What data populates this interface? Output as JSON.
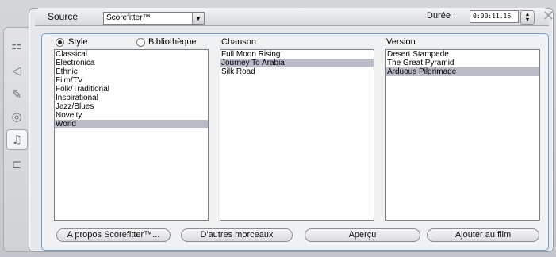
{
  "header": {
    "source_label": "Source",
    "source_value": "Scorefitter™",
    "duration_label": "Durée :",
    "duration_value": "0:00:11.16"
  },
  "sidebar": {
    "icons": [
      "timeline-icon",
      "audio-icon",
      "voice-icon",
      "disc-icon",
      "music-icon",
      "record-icon"
    ]
  },
  "columns": {
    "style_label": "Style",
    "library_label": "Bibliothèque",
    "song_label": "Chanson",
    "version_label": "Version"
  },
  "styles": [
    "Classical",
    "Electronica",
    "Ethnic",
    "Film/TV",
    "Folk/Traditional",
    "Inspirational",
    "Jazz/Blues",
    "Novelty",
    "World"
  ],
  "styles_selected": "World",
  "songs": [
    "Full Moon Rising",
    "Journey To Arabia",
    "Silk Road"
  ],
  "songs_selected": "Journey To Arabia",
  "versions": [
    "Desert Stampede",
    "The Great Pyramid",
    "Arduous Pilgrimage"
  ],
  "versions_selected": "Arduous Pilgrimage",
  "buttons": {
    "about": "A propos Scorefitter™...",
    "more": "D'autres morceaux",
    "preview": "Aperçu",
    "add": "Ajouter au film"
  }
}
